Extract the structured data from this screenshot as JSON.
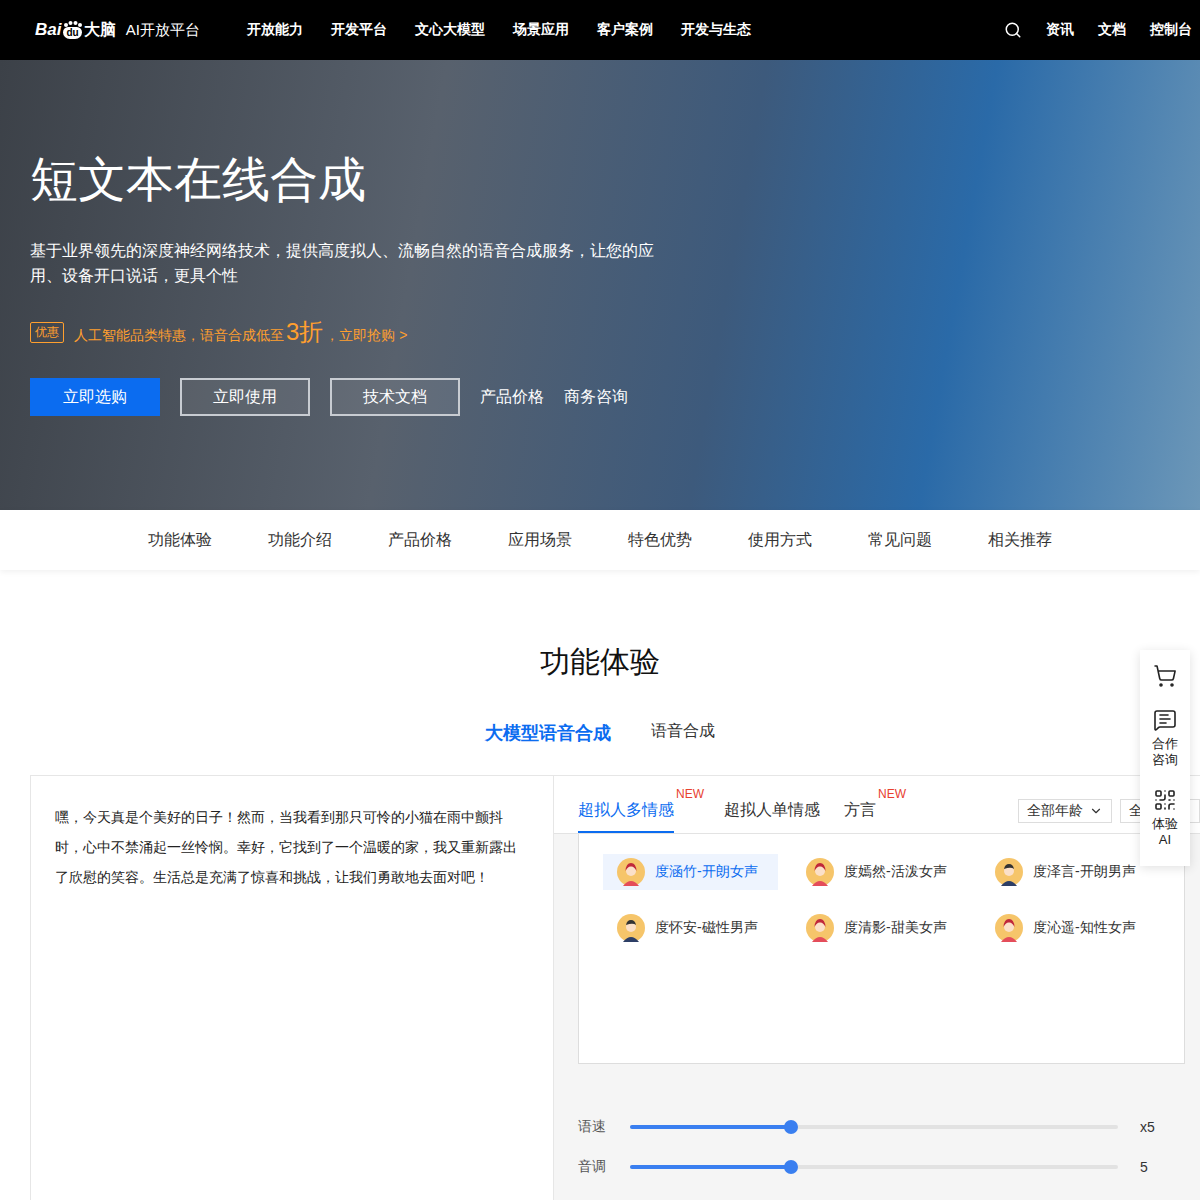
{
  "nav": {
    "logo": {
      "bai": "Bai",
      "du": "du",
      "brain": "大脑",
      "platform": "AI开放平台"
    },
    "items": [
      "开放能力",
      "开发平台",
      "文心大模型",
      "场景应用",
      "客户案例",
      "开发与生态"
    ],
    "right": [
      "资讯",
      "文档",
      "控制台"
    ]
  },
  "hero": {
    "title": "短文本在线合成",
    "description": "基于业界领先的深度神经网络技术，提供高度拟人、流畅自然的语音合成服务，让您的应用、设备开口说话，更具个性",
    "promo": {
      "badge": "优惠",
      "text": "人工智能品类特惠，语音合成低至",
      "highlight": "3折",
      "link": "，立即抢购 >"
    },
    "buttons": [
      {
        "label": "立即选购",
        "kind": "primary"
      },
      {
        "label": "立即使用",
        "kind": "outline"
      },
      {
        "label": "技术文档",
        "kind": "outline"
      },
      {
        "label": "产品价格",
        "kind": "link"
      },
      {
        "label": "商务咨询",
        "kind": "link"
      }
    ]
  },
  "subnav": [
    {
      "label": "功能体验",
      "selected": false
    },
    {
      "label": "功能介绍",
      "selected": false
    },
    {
      "label": "产品价格",
      "selected": false
    },
    {
      "label": "应用场景",
      "selected": false
    },
    {
      "label": "特色优势",
      "selected": false
    },
    {
      "label": "使用方式",
      "selected": false
    },
    {
      "label": "常见问题",
      "selected": false
    },
    {
      "label": "相关推荐",
      "selected": false
    }
  ],
  "section": {
    "title": "功能体验",
    "tabs": [
      {
        "label": "大模型语音合成",
        "selected": true
      },
      {
        "label": "语音合成",
        "selected": false
      }
    ]
  },
  "editor": {
    "text": "嘿，今天真是个美好的日子！然而，当我看到那只可怜的小猫在雨中颤抖时，心中不禁涌起一丝怜悯。幸好，它找到了一个温暖的家，我又重新露出了欣慰的笑容。生活总是充满了惊喜和挑战，让我们勇敢地去面对吧！"
  },
  "voice_tabs": [
    {
      "label": "超拟人多情感",
      "badge": "NEW",
      "selected": true
    },
    {
      "label": "超拟人单情感",
      "selected": false
    },
    {
      "label": "方言",
      "badge": "NEW",
      "selected": false
    }
  ],
  "filters": [
    "全部年龄",
    "全部性"
  ],
  "voices": [
    {
      "name": "度涵竹-开朗女声",
      "kind": "female",
      "selected": true
    },
    {
      "name": "度嫣然-活泼女声",
      "kind": "female",
      "selected": false
    },
    {
      "name": "度泽言-开朗男声",
      "kind": "male",
      "selected": false
    },
    {
      "name": "度怀安-磁性男声",
      "kind": "male",
      "selected": false
    },
    {
      "name": "度清影-甜美女声",
      "kind": "female",
      "selected": false
    },
    {
      "name": "度沁遥-知性女声",
      "kind": "female",
      "selected": false
    }
  ],
  "sliders": [
    {
      "label": "语速",
      "level": 0.33,
      "reading": "x5"
    },
    {
      "label": "音调",
      "level": 0.33,
      "reading": "5"
    }
  ],
  "float_bar": [
    {
      "kind": "cart"
    },
    {
      "kind": "consult",
      "label": "合作咨询"
    },
    {
      "kind": "qr",
      "label": "体验AI"
    }
  ]
}
